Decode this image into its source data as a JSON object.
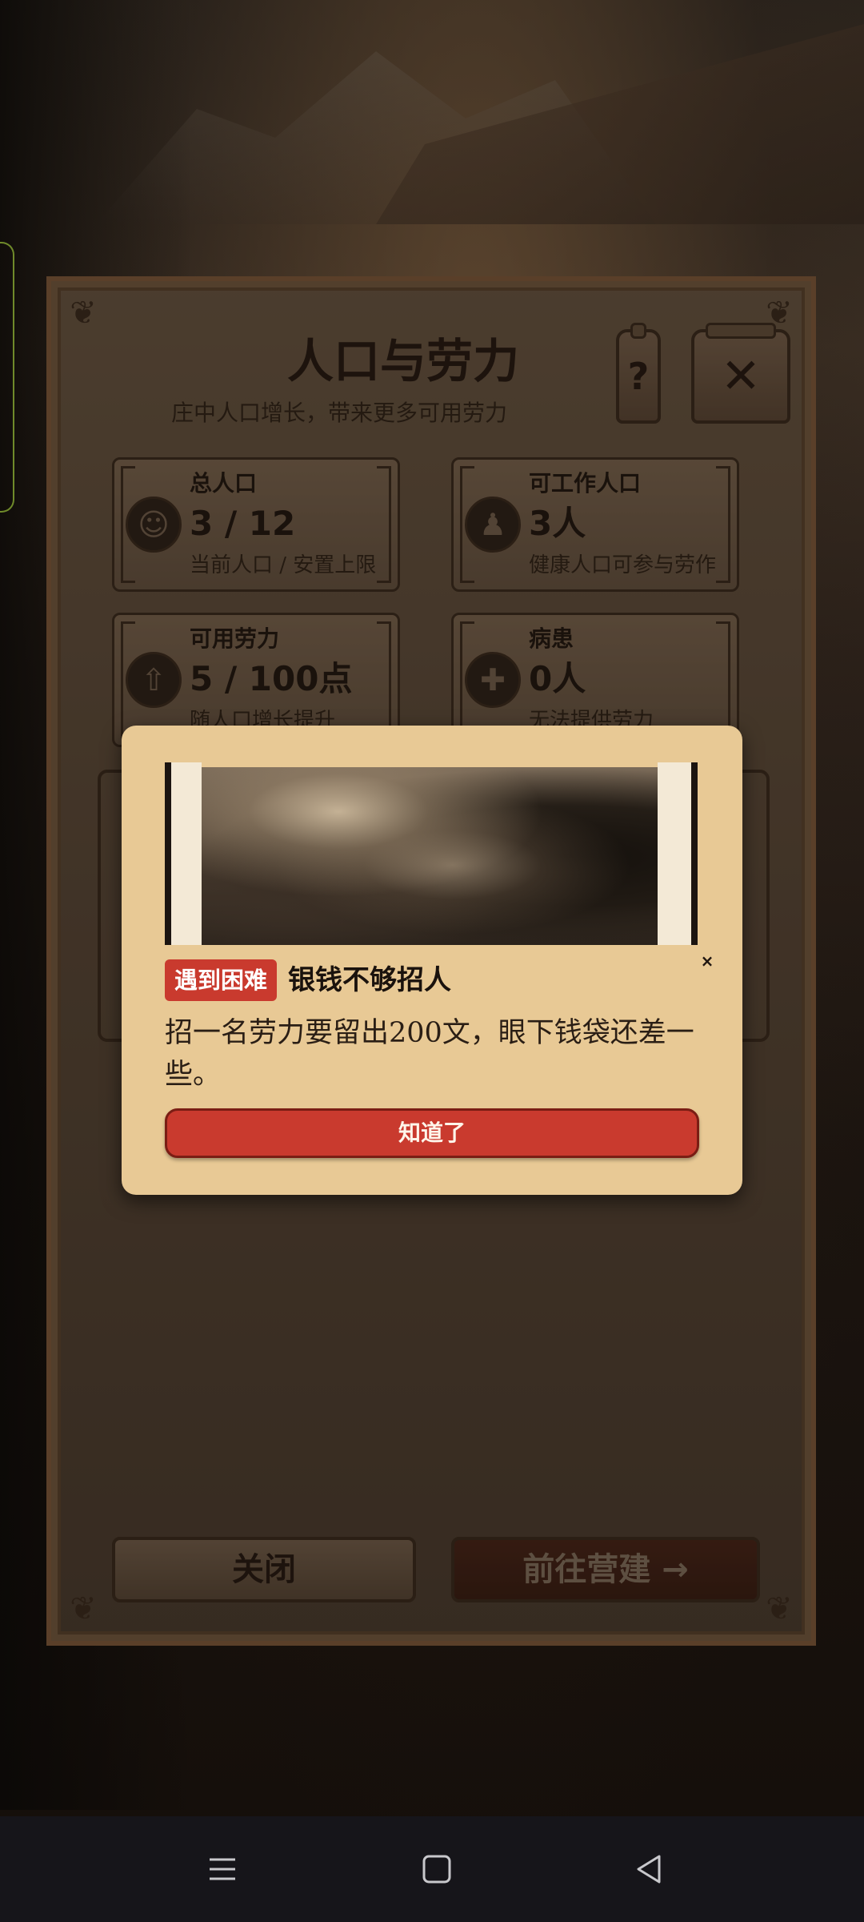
{
  "panel": {
    "title": "人口与劳力",
    "subtitle": "庄中人口增长，带来更多可用劳力",
    "help_label": "?",
    "close_label": "✕",
    "stats": [
      {
        "label": "总人口",
        "value": "3 / 12",
        "desc": "当前人口 / 安置上限",
        "icon": "villagers-icon"
      },
      {
        "label": "可工作人口",
        "value": "3人",
        "desc": "健康人口可参与劳作",
        "icon": "worker-icon"
      },
      {
        "label": "可用劳力",
        "value": "5 / 100点",
        "desc": "随人口增长提升",
        "icon": "arrow-up-icon"
      },
      {
        "label": "病患",
        "value": "0人",
        "desc": "无法提供劳力",
        "icon": "patient-icon"
      }
    ],
    "close_button": "关闭",
    "build_button": "前往营建 →"
  },
  "dialog": {
    "badge": "遇到困难",
    "title": "银钱不够招人",
    "body": "招一名劳力要留出200文，眼下钱袋还差一些。",
    "ok_button": "知道了",
    "close_label": "×"
  },
  "colors": {
    "accent_red": "#c93a2e",
    "dialog_bg": "#e8c995",
    "panel_text": "#241811"
  }
}
